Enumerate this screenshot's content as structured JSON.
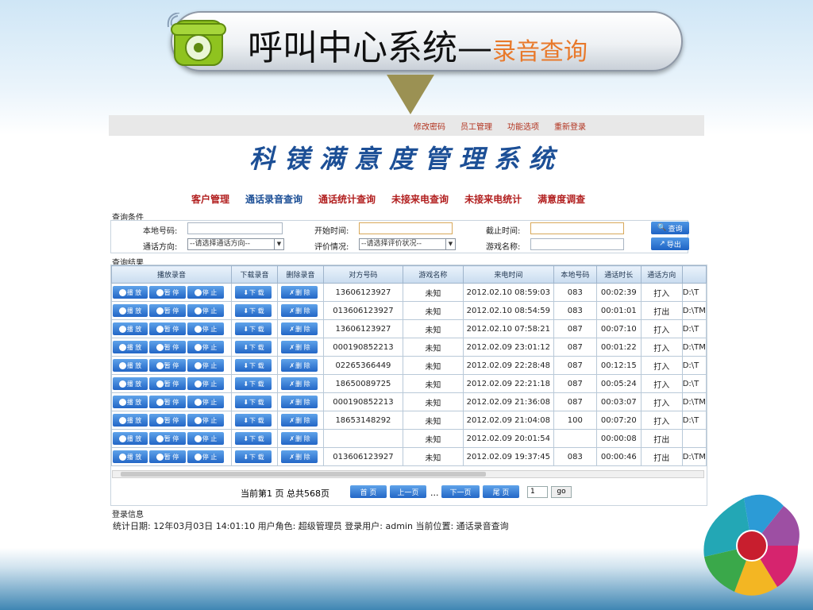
{
  "slide": {
    "title": "呼叫中心系统—",
    "subtitle": "录音查询"
  },
  "topnav": [
    "修改密码",
    "员工管理",
    "功能选项",
    "重新登录"
  ],
  "system_title": "科镁满意度管理系统",
  "mainnav": [
    {
      "label": "客户管理",
      "active": false
    },
    {
      "label": "通话录音查询",
      "active": true
    },
    {
      "label": "通话统计查询",
      "active": false
    },
    {
      "label": "未接来电查询",
      "active": false
    },
    {
      "label": "未接来电统计",
      "active": false
    },
    {
      "label": "满意度调查",
      "active": false
    }
  ],
  "query": {
    "section_title": "查询条件",
    "local_number_label": "本地号码:",
    "start_time_label": "开始时间:",
    "end_time_label": "截止时间:",
    "direction_label": "通话方向:",
    "direction_value": "--请选择通话方向--",
    "rating_label": "评价情况:",
    "rating_value": "--请选择评价状况--",
    "game_label": "游戏名称:",
    "search_button": "查询",
    "export_button": "导出"
  },
  "results": {
    "section_title": "查询结果",
    "columns": [
      "播放录音",
      "下载录音",
      "删除录音",
      "对方号码",
      "游戏名称",
      "来电时间",
      "本地号码",
      "通话时长",
      "通话方向"
    ],
    "play_label": "播 放",
    "pause_label": "暂 停",
    "stop_label": "停 止",
    "download_label": "下 载",
    "delete_label": "删 除",
    "rows": [
      {
        "peer": "13606123927",
        "game": "未知",
        "time": "2012.02.10 08:59:03",
        "local": "083",
        "duration": "00:02:39",
        "direction": "打入",
        "path": "D:\\T"
      },
      {
        "peer": "013606123927",
        "game": "未知",
        "time": "2012.02.10 08:54:59",
        "local": "083",
        "duration": "00:01:01",
        "direction": "打出",
        "path": "D:\\TM"
      },
      {
        "peer": "13606123927",
        "game": "未知",
        "time": "2012.02.10 07:58:21",
        "local": "087",
        "duration": "00:07:10",
        "direction": "打入",
        "path": "D:\\T"
      },
      {
        "peer": "000190852213",
        "game": "未知",
        "time": "2012.02.09 23:01:12",
        "local": "087",
        "duration": "00:01:22",
        "direction": "打入",
        "path": "D:\\TM"
      },
      {
        "peer": "02265366449",
        "game": "未知",
        "time": "2012.02.09 22:28:48",
        "local": "087",
        "duration": "00:12:15",
        "direction": "打入",
        "path": "D:\\T"
      },
      {
        "peer": "18650089725",
        "game": "未知",
        "time": "2012.02.09 22:21:18",
        "local": "087",
        "duration": "00:05:24",
        "direction": "打入",
        "path": "D:\\T"
      },
      {
        "peer": "000190852213",
        "game": "未知",
        "time": "2012.02.09 21:36:08",
        "local": "087",
        "duration": "00:03:07",
        "direction": "打入",
        "path": "D:\\TM"
      },
      {
        "peer": "18653148292",
        "game": "未知",
        "time": "2012.02.09 21:04:08",
        "local": "100",
        "duration": "00:07:20",
        "direction": "打入",
        "path": "D:\\T"
      },
      {
        "peer": "",
        "game": "未知",
        "time": "2012.02.09 20:01:54",
        "local": "",
        "duration": "00:00:08",
        "direction": "打出",
        "path": ""
      },
      {
        "peer": "013606123927",
        "game": "未知",
        "time": "2012.02.09 19:37:45",
        "local": "083",
        "duration": "00:00:46",
        "direction": "打出",
        "path": "D:\\TM"
      }
    ]
  },
  "pager": {
    "summary": "当前第1 页 总共568页",
    "first": "首 页",
    "prev": "上一页",
    "ellipsis": "...",
    "next": "下一页",
    "last": "尾 页",
    "page_input": "1",
    "go": "go"
  },
  "login": {
    "section_title": "登录信息",
    "info": "统计日期: 12年03月03日 14:01:10   用户角色: 超级管理员   登录用户: admin   当前位置: 通话录音查询"
  },
  "colors": {
    "accent_blue": "#1c4f96",
    "nav_red": "#b22020",
    "subtitle_orange": "#e8792b"
  }
}
